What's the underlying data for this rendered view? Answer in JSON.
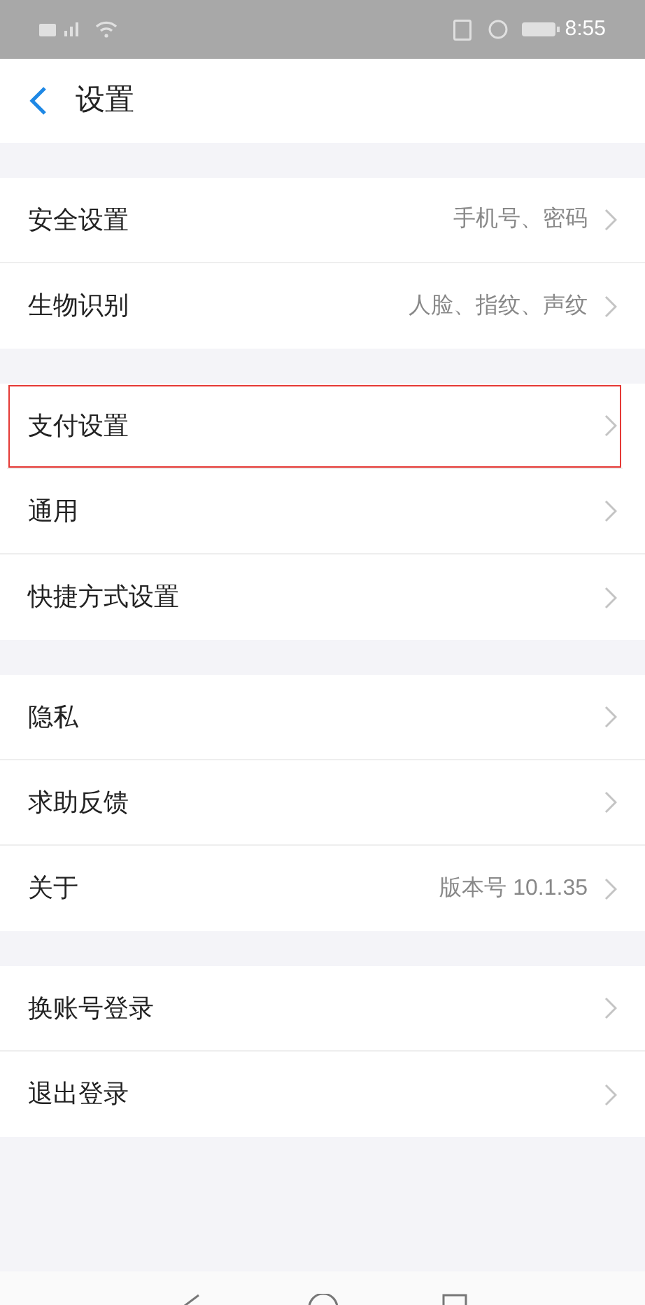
{
  "status_bar": {
    "time": "8:55"
  },
  "header": {
    "title": "设置"
  },
  "groups": [
    {
      "items": [
        {
          "label": "安全设置",
          "value": "手机号、密码",
          "highlighted": false
        },
        {
          "label": "生物识别",
          "value": "人脸、指纹、声纹",
          "highlighted": false
        }
      ]
    },
    {
      "items": [
        {
          "label": "支付设置",
          "highlighted": true
        },
        {
          "label": "通用",
          "highlighted": false
        },
        {
          "label": "快捷方式设置",
          "highlighted": false
        }
      ]
    },
    {
      "items": [
        {
          "label": "隐私",
          "highlighted": false
        },
        {
          "label": "求助反馈",
          "highlighted": false
        },
        {
          "label": "关于",
          "value": "版本号 10.1.35",
          "highlighted": false
        }
      ]
    },
    {
      "items": [
        {
          "label": "换账号登录",
          "highlighted": false
        },
        {
          "label": "退出登录",
          "highlighted": false
        }
      ]
    }
  ]
}
